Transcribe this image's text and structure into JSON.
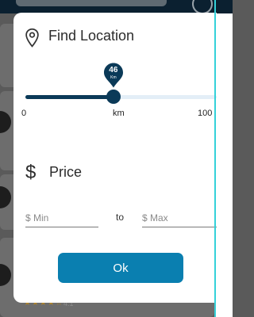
{
  "location": {
    "title": "Find Location",
    "slider": {
      "value": 46,
      "value_label": "46",
      "unit_small": "Km",
      "min": 0,
      "max": 100,
      "tick_min": "0",
      "tick_mid": "km",
      "tick_max": "100"
    }
  },
  "price": {
    "title": "Price",
    "icon_glyph": "$",
    "min_placeholder": "$ Min",
    "to_label": "to",
    "max_placeholder": "$ Max"
  },
  "actions": {
    "ok_label": "Ok"
  },
  "background": {
    "stars": "★★★★☆",
    "rating_text": "4.1"
  },
  "colors": {
    "accent_dark": "#0b3a58",
    "button": "#0a7fb0",
    "track": "#e3eef7",
    "teal_guide": "#34d1d9"
  }
}
